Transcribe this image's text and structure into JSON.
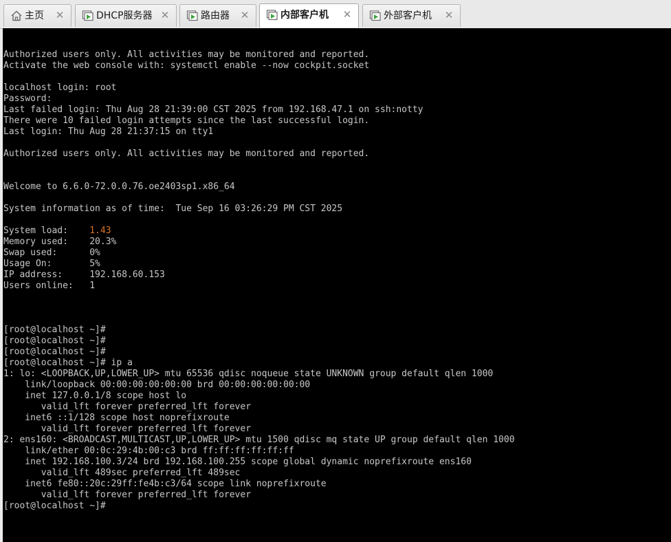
{
  "tabs": [
    {
      "label": "主页",
      "icon": "home-icon",
      "active": false
    },
    {
      "label": "DHCP服务器",
      "icon": "vm-icon",
      "active": false
    },
    {
      "label": "路由器",
      "icon": "vm-icon",
      "active": false
    },
    {
      "label": "内部客户机",
      "icon": "vm-icon",
      "active": true
    },
    {
      "label": "外部客户机",
      "icon": "vm-icon",
      "active": false
    }
  ],
  "close_glyph": "✕",
  "colors": {
    "console_bg": "#000000",
    "console_fg": "#c8c8c8",
    "load_highlight": "#d9722a"
  },
  "console": {
    "lines": [
      "Authorized users only. All activities may be monitored and reported.",
      "Activate the web console with: systemctl enable --now cockpit.socket",
      "",
      "localhost login: root",
      "Password:",
      "Last failed login: Thu Aug 28 21:39:00 CST 2025 from 192.168.47.1 on ssh:notty",
      "There were 10 failed login attempts since the last successful login.",
      "Last login: Thu Aug 28 21:37:15 on tty1",
      "",
      "Authorized users only. All activities may be monitored and reported.",
      "",
      "",
      "Welcome to 6.6.0-72.0.0.76.oe2403sp1.x86_64",
      "",
      "System information as of time:  Tue Sep 16 03:26:29 PM CST 2025",
      "",
      "System load:    ",
      "Memory used:    20.3%",
      "Swap used:      0%",
      "Usage On:       5%",
      "IP address:     192.168.60.153",
      "Users online:   1",
      "",
      "",
      "",
      "[root@localhost ~]#",
      "[root@localhost ~]#",
      "[root@localhost ~]#",
      "[root@localhost ~]# ip a",
      "1: lo: <LOOPBACK,UP,LOWER_UP> mtu 65536 qdisc noqueue state UNKNOWN group default qlen 1000",
      "    link/loopback 00:00:00:00:00:00 brd 00:00:00:00:00:00",
      "    inet 127.0.0.1/8 scope host lo",
      "       valid_lft forever preferred_lft forever",
      "    inet6 ::1/128 scope host noprefixroute",
      "       valid_lft forever preferred_lft forever",
      "2: ens160: <BROADCAST,MULTICAST,UP,LOWER_UP> mtu 1500 qdisc mq state UP group default qlen 1000",
      "    link/ether 00:0c:29:4b:00:c3 brd ff:ff:ff:ff:ff:ff",
      "    inet 192.168.100.3/24 brd 192.168.100.255 scope global dynamic noprefixroute ens160",
      "       valid_lft 489sec preferred_lft 489sec",
      "    inet6 fe80::20c:29ff:fe4b:c3/64 scope link noprefixroute",
      "       valid_lft forever preferred_lft forever",
      "[root@localhost ~]#"
    ],
    "system_load_value": "1.43"
  }
}
